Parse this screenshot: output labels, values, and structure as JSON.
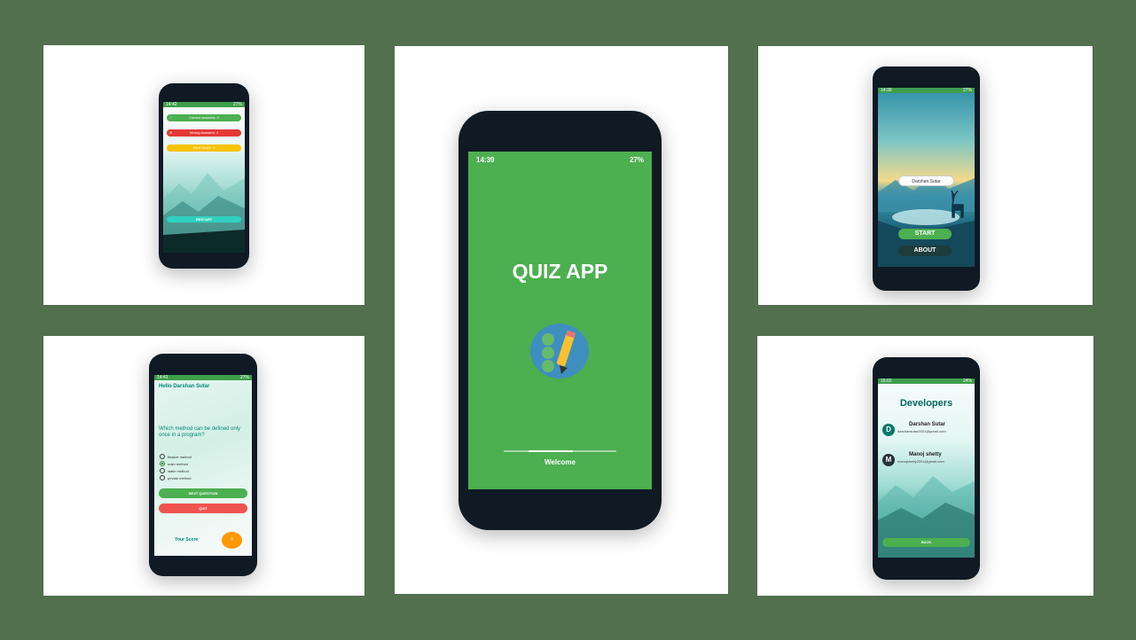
{
  "results": {
    "status_time": "14:42",
    "status_right": "27%",
    "correct_label": "Correct answers: 3",
    "wrong_label": "Wrong Answers: 2",
    "final_label": "Final Score: 3",
    "restart_label": "RESTART"
  },
  "splash": {
    "status_time": "14:39",
    "status_right": "27%",
    "title": "QUIZ APP",
    "loading_text": "Welcome"
  },
  "start": {
    "status_time": "14:39",
    "status_right": "27%",
    "name_value": "Darshan Sutar",
    "start_label": "START",
    "about_label": "ABOUT"
  },
  "question": {
    "status_time": "14:41",
    "status_right": "27%",
    "greeting": "Hello Darshan Sutar",
    "question_text": "Which method can be defined only once in a program?",
    "options": [
      "finalize method",
      "main method",
      "static method",
      "private method"
    ],
    "selected_index": 1,
    "next_label": "NEXT QUESTION",
    "quit_label": "QUIT",
    "score_label": "Your Score",
    "score_value": "0"
  },
  "developers": {
    "status_time": "15:02",
    "status_right": "24%",
    "title": "Developers",
    "people": [
      {
        "initial": "D",
        "name": "Darshan Sutar",
        "email": "darshansutar2001@gmail.com"
      },
      {
        "initial": "M",
        "name": "Manoj shetty",
        "email": "manojshetty2001@gmail.com"
      }
    ],
    "back_label": "BACK"
  },
  "colors": {
    "background": "#526f4e",
    "green": "#4caf50",
    "red": "#e53935",
    "yellow": "#f9c300",
    "teal": "#2fd1c0",
    "phone": "#0f1a24"
  }
}
